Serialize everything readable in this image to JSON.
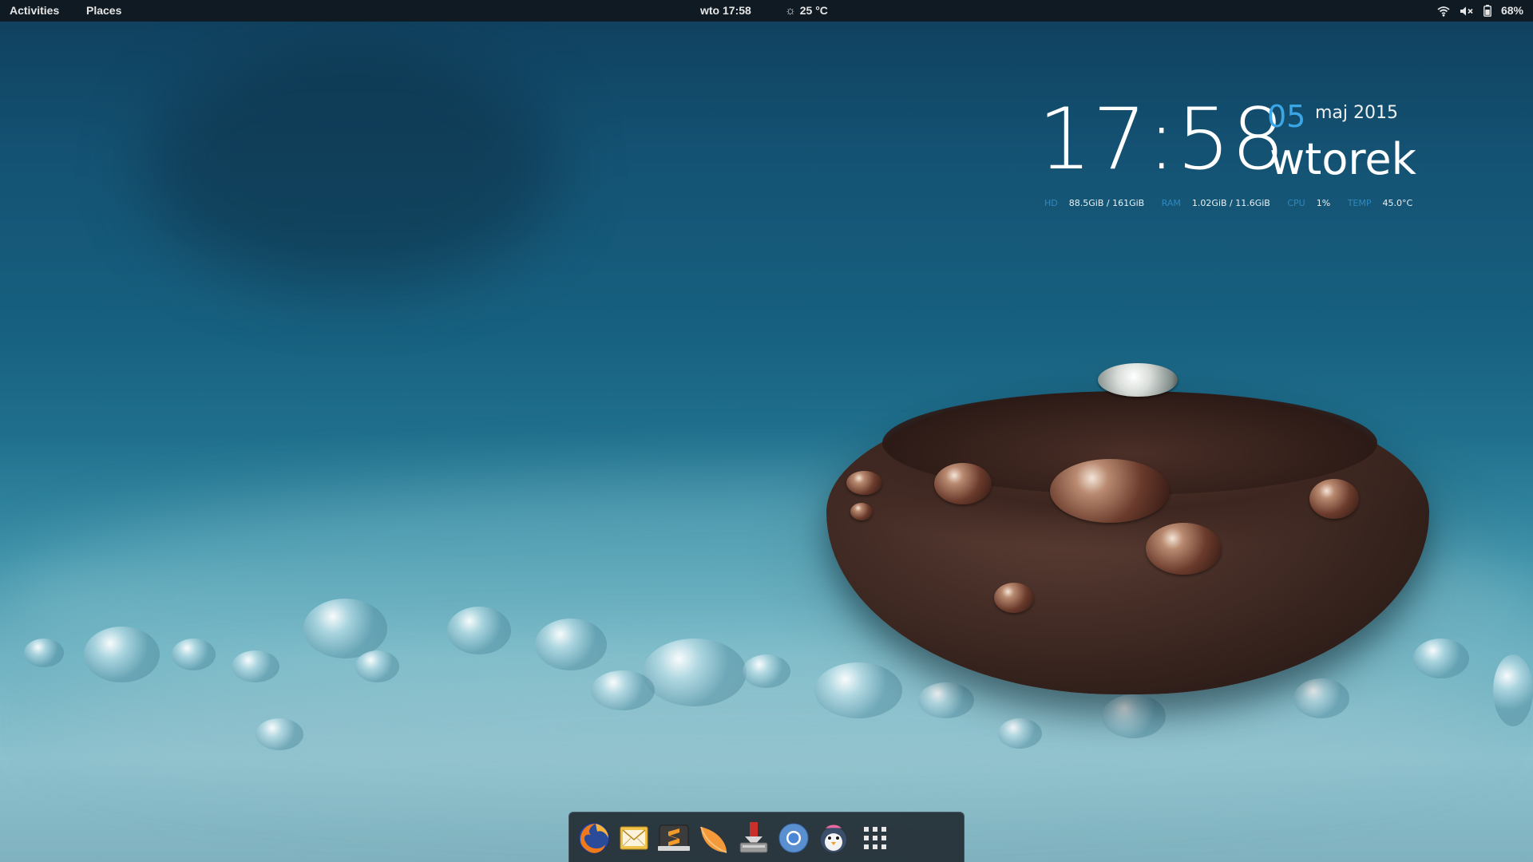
{
  "topbar": {
    "activities": "Activities",
    "places": "Places",
    "clock": "wto 17:58",
    "weather": "25 °C",
    "weather_icon": "sun-icon",
    "battery_percent": "68%",
    "icons": [
      "wifi-icon",
      "volume-muted-icon",
      "battery-icon"
    ]
  },
  "clock_widget": {
    "time": "17:58",
    "day": "05",
    "month_year": "maj 2015",
    "weekday": "wtorek",
    "stats": [
      {
        "label": "HD",
        "value": "88.5GiB / 161GiB"
      },
      {
        "label": "RAM",
        "value": "1.02GiB / 11.6GiB"
      },
      {
        "label": "CPU",
        "value": "1%"
      },
      {
        "label": "TEMP",
        "value": "45.0°C"
      }
    ],
    "colors": {
      "accent": "#3aa6e6",
      "label": "#2f88bf",
      "text": "#ffffff"
    }
  },
  "dock": {
    "apps": [
      {
        "name": "firefox-icon"
      },
      {
        "name": "mail-icon"
      },
      {
        "name": "sublime-text-icon"
      },
      {
        "name": "orange-slice-icon"
      },
      {
        "name": "download-manager-icon"
      },
      {
        "name": "chromium-icon"
      },
      {
        "name": "bird-chat-icon"
      },
      {
        "name": "app-grid-icon"
      }
    ]
  },
  "colors": {
    "topbar_bg": "#101a22",
    "desktop_blue": "#17607f"
  }
}
